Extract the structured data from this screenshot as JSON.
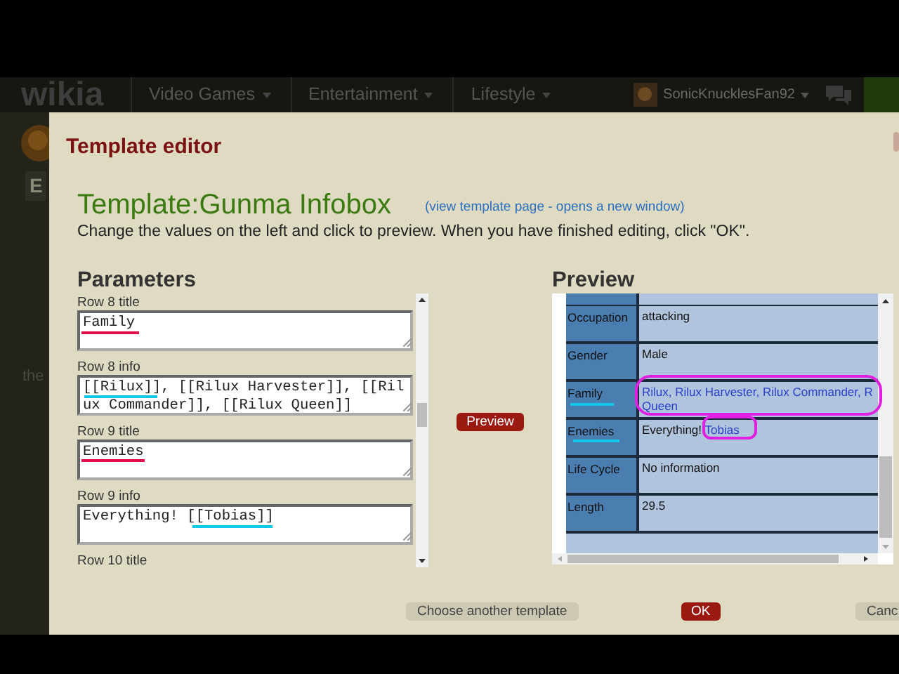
{
  "top_nav": {
    "logo": "wikia",
    "menus": [
      {
        "label": "Video Games"
      },
      {
        "label": "Entertainment"
      },
      {
        "label": "Lifestyle"
      }
    ],
    "username": "SonicKnucklesFan92"
  },
  "background_page": {
    "fragments": [
      "E",
      "the"
    ]
  },
  "dialog": {
    "title": "Template editor",
    "template_name": "Template:Gunma Infobox",
    "template_link": "(view template page - opens a new window)",
    "instructions": "Change the values on the left and click to preview. When you have finished editing, click \"OK\".",
    "parameters": {
      "heading": "Parameters",
      "fields": [
        {
          "label": "Row 8 title",
          "value": "Family"
        },
        {
          "label": "Row 8 info",
          "value": "[[Rilux]], [[Rilux Harvester]], [[Rilux Commander]], [[Rilux Queen]]"
        },
        {
          "label": "Row 9 title",
          "value": "Enemies"
        },
        {
          "label": "Row 9 info",
          "value": "Everything! [[Tobias]]"
        },
        {
          "label": "Row 10 title"
        }
      ]
    },
    "preview_button": "Preview",
    "preview": {
      "heading": "Preview",
      "rows": [
        {
          "label": "Occupation",
          "value": [
            {
              "kind": "text",
              "text": "attacking"
            }
          ]
        },
        {
          "label": "Gender",
          "value": [
            {
              "kind": "text",
              "text": "Male"
            }
          ]
        },
        {
          "label": "Family",
          "value": [
            {
              "kind": "link",
              "text": "Rilux, Rilux Harvester, Rilux Commander, R"
            },
            {
              "kind": "break"
            },
            {
              "kind": "link",
              "text": "Queen"
            }
          ]
        },
        {
          "label": "Enemies",
          "value": [
            {
              "kind": "text",
              "text": "Everything!"
            },
            {
              "kind": "link",
              "text": "Tobias"
            }
          ]
        },
        {
          "label": "Life Cycle",
          "value": [
            {
              "kind": "text",
              "text": "No information"
            }
          ]
        },
        {
          "label": "Length",
          "value": [
            {
              "kind": "text",
              "text": "29.5"
            }
          ]
        }
      ]
    },
    "buttons": [
      {
        "label": "Choose another template",
        "kind": "secondary"
      },
      {
        "label": "OK",
        "kind": "primary"
      },
      {
        "label": "Canc",
        "kind": "secondary"
      }
    ]
  }
}
